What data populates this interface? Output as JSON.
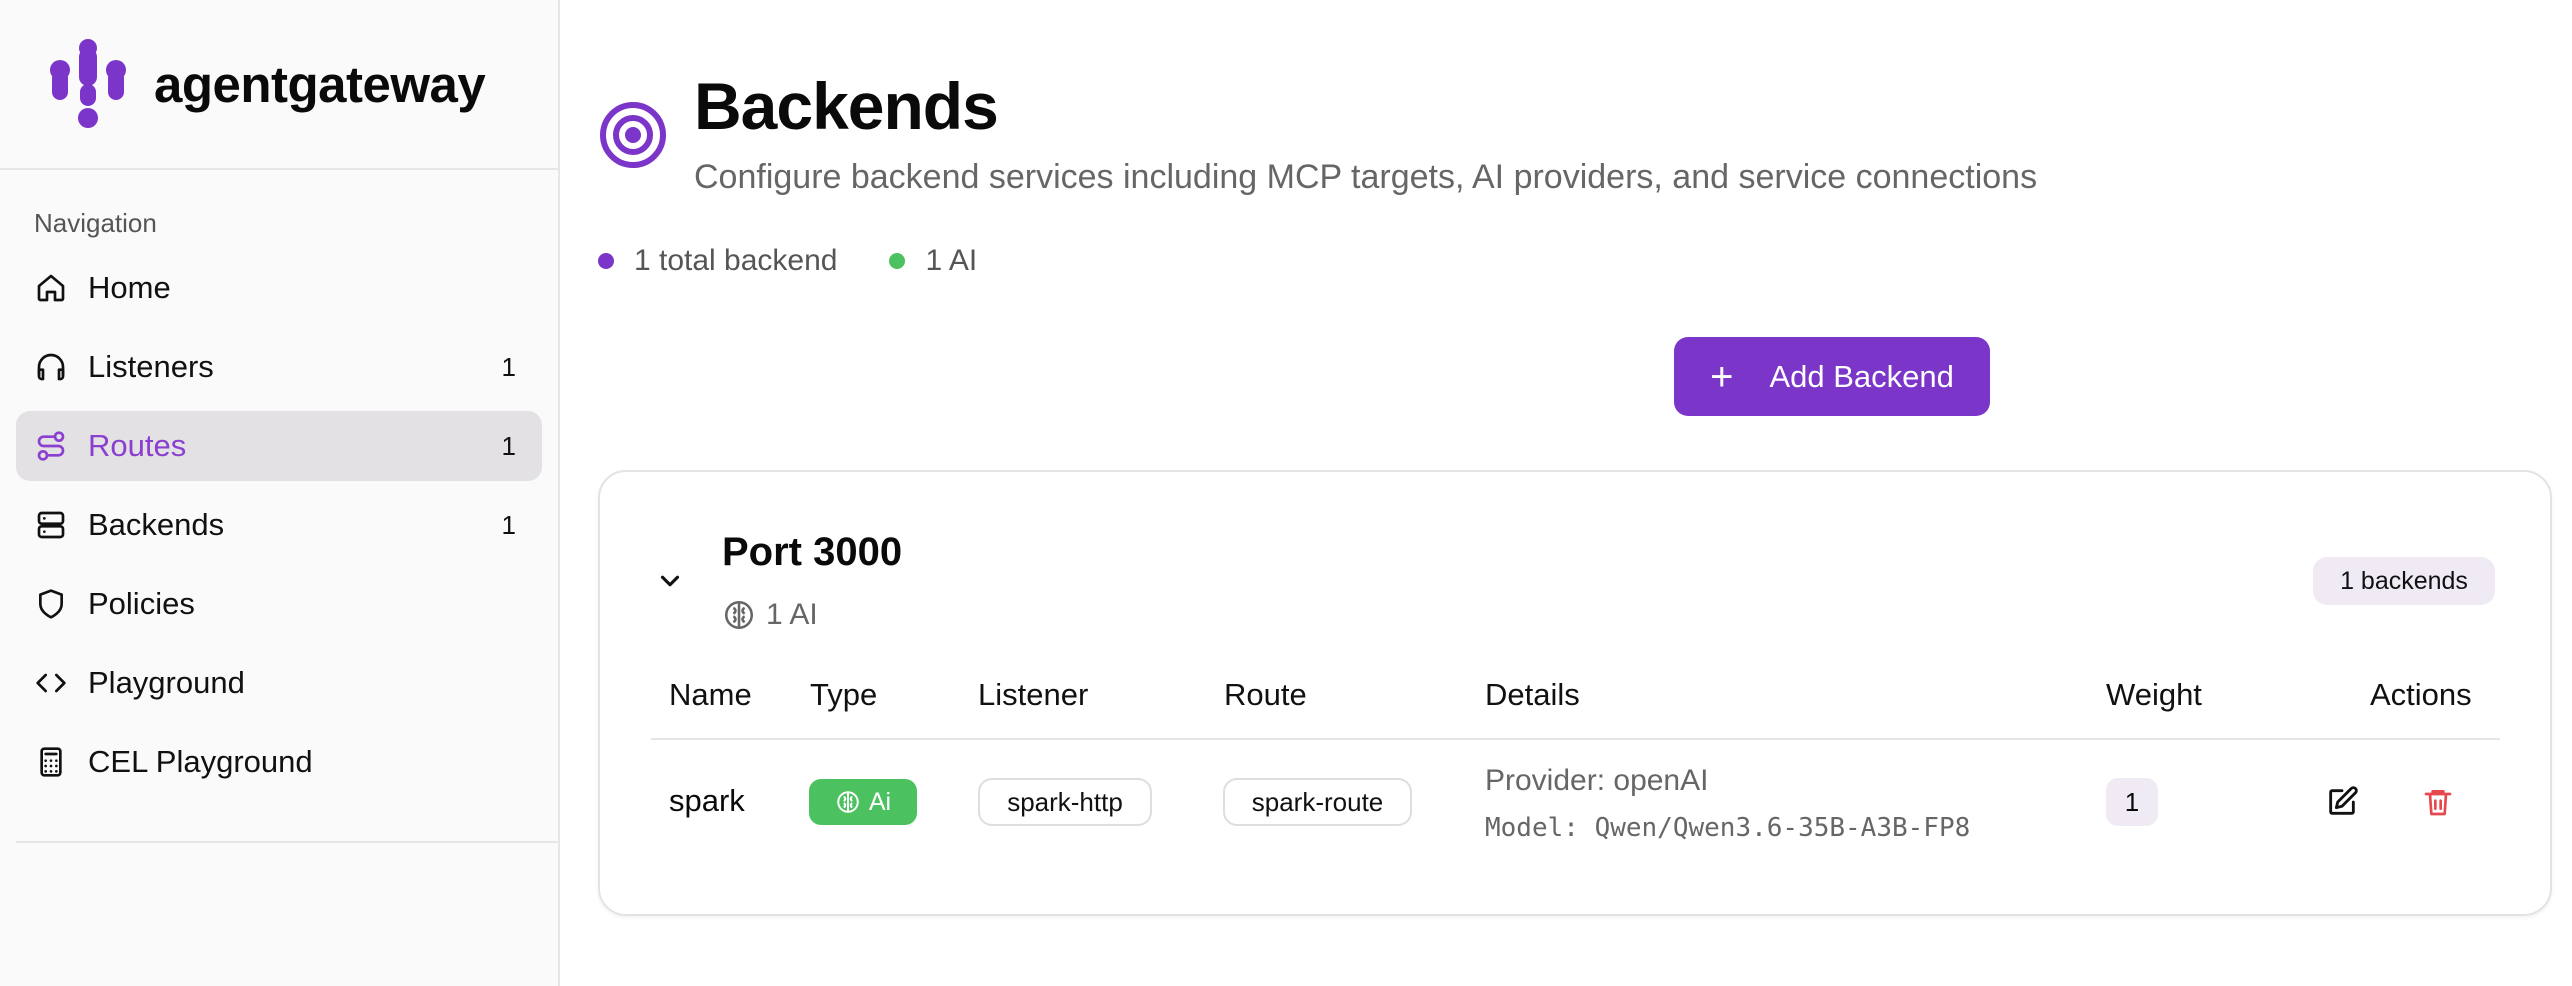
{
  "brand": {
    "name": "agentgateway"
  },
  "sidebar": {
    "heading": "Navigation",
    "items": [
      {
        "label": "Home",
        "count": "",
        "icon": "home-icon",
        "active": false
      },
      {
        "label": "Listeners",
        "count": "1",
        "icon": "headphones-icon",
        "active": false
      },
      {
        "label": "Routes",
        "count": "1",
        "icon": "route-icon",
        "active": true
      },
      {
        "label": "Backends",
        "count": "1",
        "icon": "server-icon",
        "active": false
      },
      {
        "label": "Policies",
        "count": "",
        "icon": "shield-icon",
        "active": false
      },
      {
        "label": "Playground",
        "count": "",
        "icon": "code-icon",
        "active": false
      },
      {
        "label": "CEL Playground",
        "count": "",
        "icon": "calculator-icon",
        "active": false
      }
    ]
  },
  "header": {
    "title": "Backends",
    "subtitle": "Configure backend services including MCP targets, AI providers, and service connections",
    "icon": "target-icon"
  },
  "stats": [
    {
      "label": "1 total backend",
      "color": "#7b35c8"
    },
    {
      "label": "1 AI",
      "color": "#4bc160"
    }
  ],
  "actions": {
    "add_label": "Add Backend"
  },
  "group": {
    "title": "Port 3000",
    "subtitle": "1 AI",
    "count_badge": "1 backends",
    "columns": [
      "Name",
      "Type",
      "Listener",
      "Route",
      "Details",
      "Weight",
      "Actions"
    ],
    "rows": [
      {
        "name": "spark",
        "type": "Ai",
        "listener": "spark-http",
        "route": "spark-route",
        "provider": "Provider: openAI",
        "model": "Model: Qwen/Qwen3.6-35B-A3B-FP8",
        "weight": "1"
      }
    ]
  },
  "colors": {
    "accent": "#7b35c8",
    "ai_green": "#4bc160",
    "active_nav_text": "#8b3fd0",
    "delete_red": "#e5484d"
  }
}
